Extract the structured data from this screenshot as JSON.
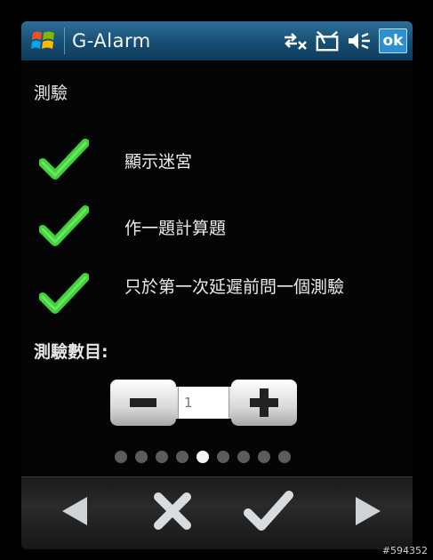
{
  "titlebar": {
    "app_title": "G-Alarm",
    "ok_label": "ok",
    "icons": [
      "windows-start-icon",
      "connectivity-icon",
      "signal-off-icon",
      "volume-muted-icon"
    ]
  },
  "section_title": "測驗",
  "options": [
    {
      "label": "顯示迷宮",
      "checked": true
    },
    {
      "label": "作一題計算題",
      "checked": true
    },
    {
      "label": "只於第一次延遲前問一個測驗",
      "checked": true
    }
  ],
  "count_label": "測驗數目:",
  "stepper": {
    "value": "1"
  },
  "pager": {
    "total": 9,
    "active_index": 4
  },
  "bottom_buttons": [
    "previous-arrow-icon",
    "cancel-x-icon",
    "confirm-check-icon",
    "next-arrow-icon"
  ],
  "watermark": "#594352",
  "colors": {
    "check_green": "#3fd23a",
    "title_blue": "#1b5a84"
  }
}
